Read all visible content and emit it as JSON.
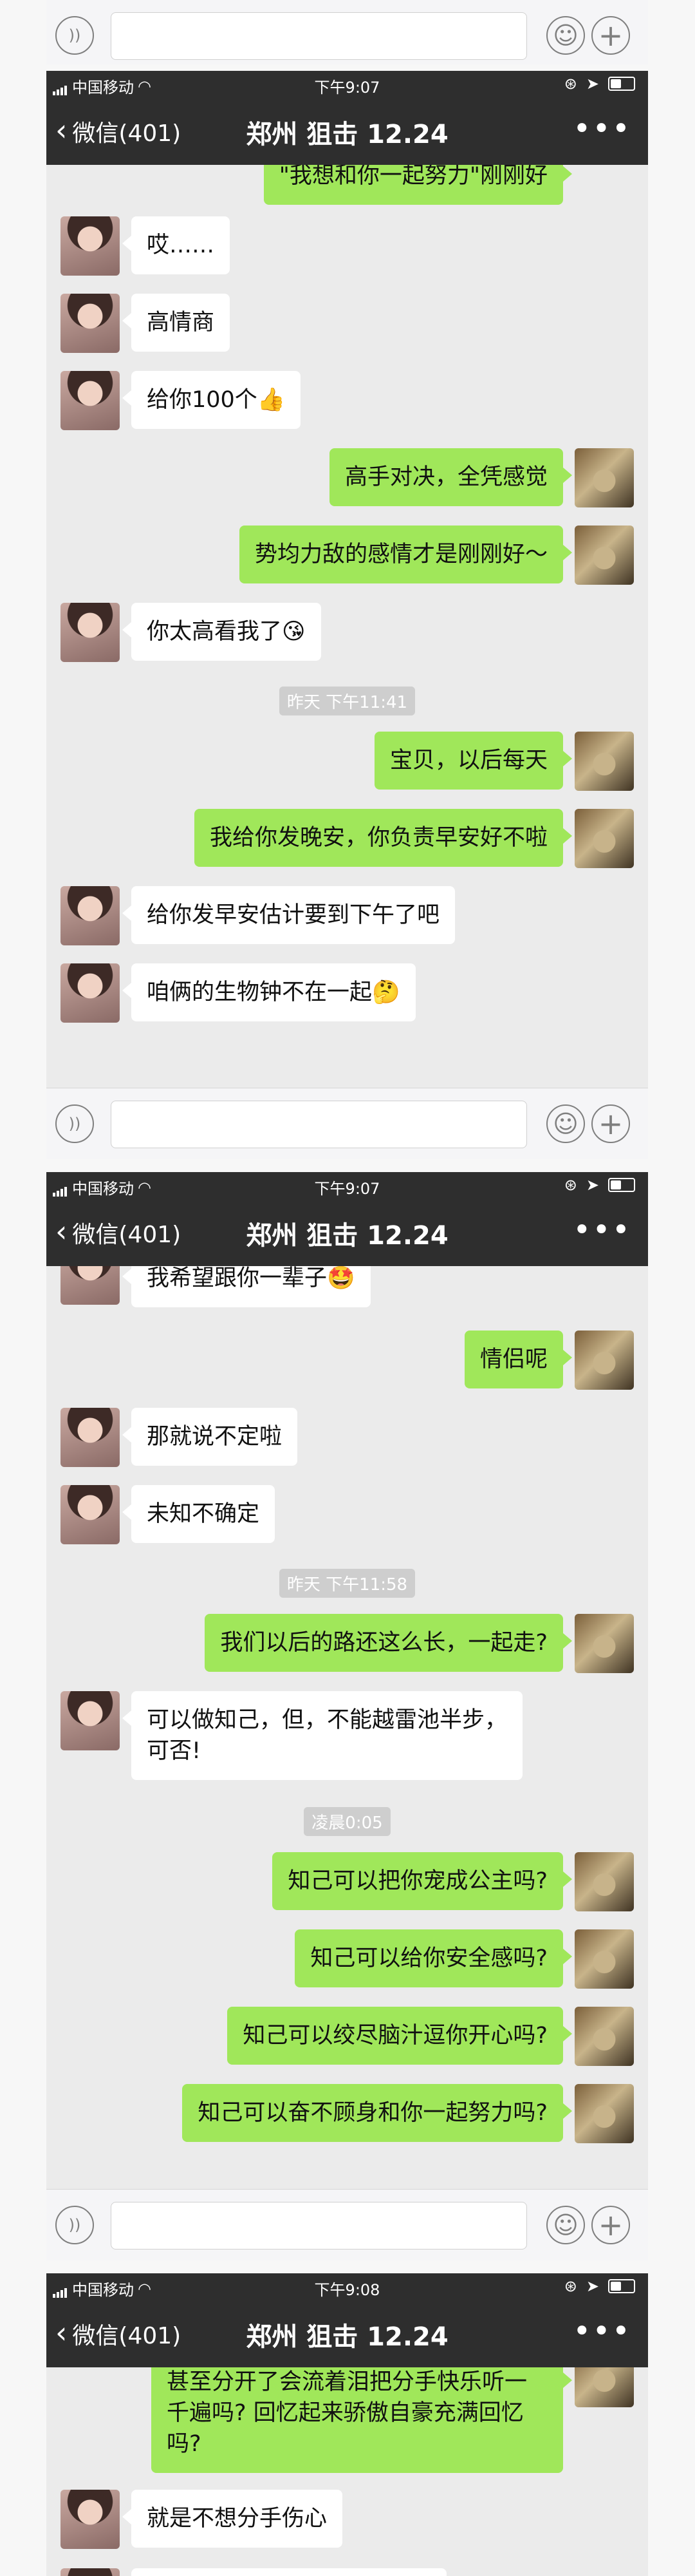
{
  "status": {
    "carrier": "中国移动",
    "time1": "下午9:07",
    "time2": "下午9:07",
    "time3": "下午9:08"
  },
  "nav": {
    "back_label": "微信(401)",
    "title": "郑州 狙击 12.24",
    "more": "•••"
  },
  "screen1": {
    "top_partial": "\"我想和你一起努力\"刚刚好",
    "messages": [
      {
        "side": "left",
        "text": "哎……"
      },
      {
        "side": "left",
        "text": "高情商"
      },
      {
        "side": "left",
        "text": "给你100个👍"
      },
      {
        "side": "right",
        "text": "高手对决，全凭感觉"
      },
      {
        "side": "right",
        "text": "势均力敌的感情才是刚刚好～"
      },
      {
        "side": "left",
        "text": "你太高看我了😘"
      },
      {
        "side": "right",
        "text": "宝贝，以后每天"
      },
      {
        "side": "right",
        "text": "我给你发晚安，你负责早安好不啦"
      },
      {
        "side": "left",
        "text": "给你发早安估计要到下午了吧"
      },
      {
        "side": "left",
        "text": "咱俩的生物钟不在一起🤔"
      }
    ],
    "timestamp": "昨天 下午11:41"
  },
  "screen2": {
    "messages": [
      {
        "side": "left",
        "text": "我希望跟你一辈子🤩"
      },
      {
        "side": "right",
        "text": "情侣呢"
      },
      {
        "side": "left",
        "text": "那就说不定啦"
      },
      {
        "side": "left",
        "text": "未知不确定"
      },
      {
        "side": "right",
        "text": "我们以后的路还这么长，一起走?"
      },
      {
        "side": "left",
        "text": "可以做知己，但，不能越雷池半步，\n可否!"
      },
      {
        "side": "right",
        "text": "知己可以把你宠成公主吗?"
      },
      {
        "side": "right",
        "text": "知己可以给你安全感吗?"
      },
      {
        "side": "right",
        "text": "知己可以绞尽脑汁逗你开心吗?"
      },
      {
        "side": "right",
        "text": "知己可以奋不顾身和你一起努力吗?"
      }
    ],
    "timestamp1": "昨天 下午11:58",
    "timestamp2": "凌晨0:05"
  },
  "screen3": {
    "messages": [
      {
        "side": "right",
        "text": "甚至分开了会流着泪把分手快乐听一\n千遍吗? 回忆起来骄傲自豪充满回忆\n吗?"
      },
      {
        "side": "left",
        "text": "就是不想分手伤心"
      }
    ]
  },
  "icons": {
    "voice": "🔊",
    "emoji": "☺",
    "plus": "+"
  },
  "colors": {
    "nav_bg": "#2e2e2e",
    "chat_bg": "#ebebeb",
    "bubble_me": "#a0e75a",
    "bubble_her": "#ffffff"
  }
}
